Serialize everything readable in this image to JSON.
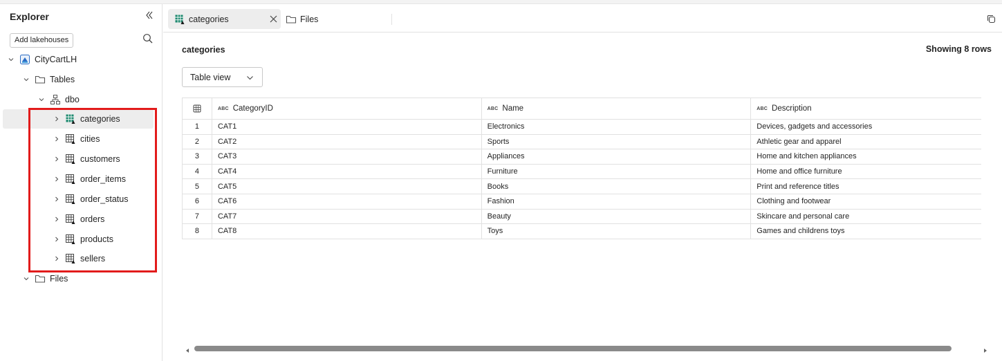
{
  "sidebar": {
    "title": "Explorer",
    "add_button": "Add lakehouses",
    "tree": [
      {
        "label": "CityCartLH",
        "icon": "lakehouse-icon"
      },
      {
        "label": "Tables",
        "icon": "folder-icon"
      },
      {
        "label": "dbo",
        "icon": "schema-icon"
      },
      {
        "label": "categories",
        "icon": "table-icon",
        "selected": true
      },
      {
        "label": "cities",
        "icon": "table-icon"
      },
      {
        "label": "customers",
        "icon": "table-icon"
      },
      {
        "label": "order_items",
        "icon": "table-icon"
      },
      {
        "label": "order_status",
        "icon": "table-icon"
      },
      {
        "label": "orders",
        "icon": "table-icon"
      },
      {
        "label": "products",
        "icon": "table-icon"
      },
      {
        "label": "sellers",
        "icon": "table-icon"
      },
      {
        "label": "Files",
        "icon": "folder-icon"
      }
    ]
  },
  "tabs": {
    "active": "categories",
    "second": "Files"
  },
  "main": {
    "title": "categories",
    "row_count": "Showing 8 rows",
    "view_select": "Table view",
    "columns": [
      {
        "type": "ABC",
        "name": "CategoryID"
      },
      {
        "type": "ABC",
        "name": "Name"
      },
      {
        "type": "ABC",
        "name": "Description"
      }
    ],
    "rows": [
      [
        "1",
        "CAT1",
        "Electronics",
        "Devices, gadgets and accessories"
      ],
      [
        "2",
        "CAT2",
        "Sports",
        "Athletic gear and apparel"
      ],
      [
        "3",
        "CAT3",
        "Appliances",
        "Home and kitchen appliances"
      ],
      [
        "4",
        "CAT4",
        "Furniture",
        "Home and office furniture"
      ],
      [
        "5",
        "CAT5",
        "Books",
        "Print and reference titles"
      ],
      [
        "6",
        "CAT6",
        "Fashion",
        "Clothing and footwear"
      ],
      [
        "7",
        "CAT7",
        "Beauty",
        "Skincare and personal care"
      ],
      [
        "8",
        "CAT8",
        "Toys",
        "Games and childrens toys"
      ]
    ]
  },
  "colors": {
    "highlight": "#e21b1b",
    "table_icon_active": "#1f8a70",
    "selection_bg": "#ededed"
  }
}
